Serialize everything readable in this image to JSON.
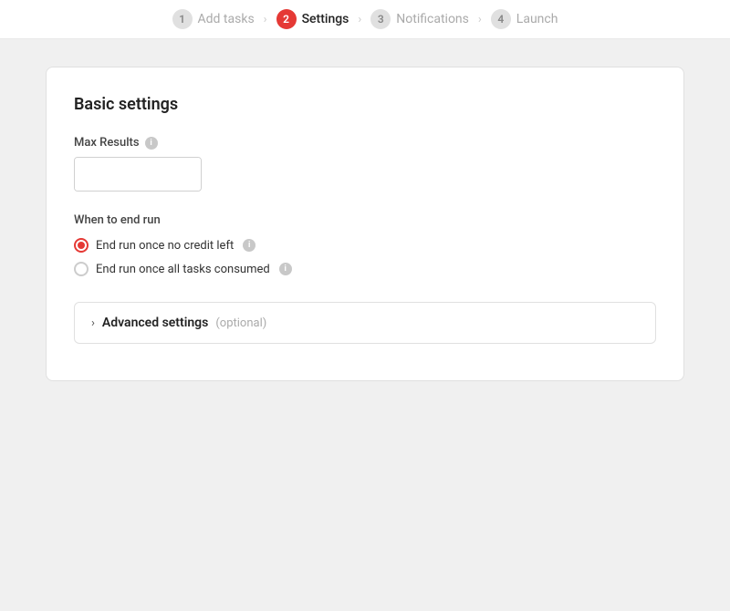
{
  "stepper": {
    "steps": [
      {
        "number": "1",
        "label": "Add tasks",
        "active": false
      },
      {
        "number": "2",
        "label": "Settings",
        "active": true
      },
      {
        "number": "3",
        "label": "Notifications",
        "active": false
      },
      {
        "number": "4",
        "label": "Launch",
        "active": false
      }
    ]
  },
  "card": {
    "title": "Basic settings",
    "max_results_label": "Max Results",
    "max_results_value": "",
    "max_results_placeholder": "",
    "when_to_end_label": "When to end run",
    "radio_options": [
      {
        "id": "option1",
        "label": "End run once no credit left",
        "checked": true
      },
      {
        "id": "option2",
        "label": "End run once all tasks consumed",
        "checked": false
      }
    ],
    "advanced_settings_label": "Advanced settings",
    "advanced_settings_optional": "(optional)",
    "info_icon_label": "i",
    "toggle_icon_label": "i",
    "toggle_icon2_label": "i"
  },
  "icons": {
    "chevron": "›",
    "plus": "+",
    "minus": "−",
    "chevron_right": "›"
  }
}
